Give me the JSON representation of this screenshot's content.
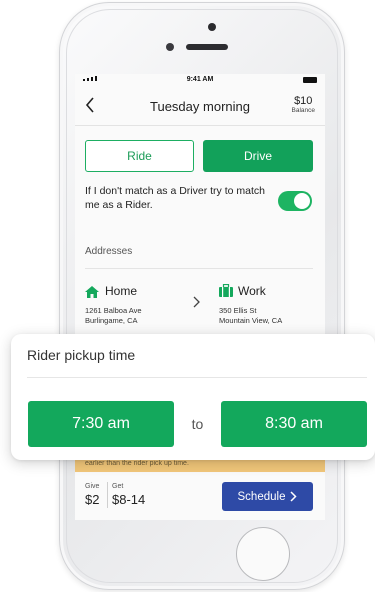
{
  "status_bar": {
    "time": "9:41 AM"
  },
  "header": {
    "back_icon": "chevron-left-icon",
    "title": "Tuesday morning",
    "balance_amount": "$10",
    "balance_label": "Balance"
  },
  "mode_toggle": {
    "ride_label": "Ride",
    "drive_label": "Drive",
    "selected": "Drive"
  },
  "match_option": {
    "text": "If I don't match as a Driver try to match me as a Rider.",
    "enabled": true
  },
  "addresses": {
    "label": "Addresses",
    "home": {
      "icon": "home-icon",
      "title": "Home",
      "line1": "1261 Balboa Ave",
      "line2": "Burlingame, CA"
    },
    "work": {
      "icon": "briefcase-icon",
      "title": "Work",
      "line1": "350 Ellis St",
      "line2": "Mountain View, CA"
    }
  },
  "notice": {
    "text": "earlier than the rider pick up time."
  },
  "footer": {
    "give_label": "Give",
    "give_amount": "$2",
    "get_label": "Get",
    "get_amount": "$8-14",
    "schedule_label": "Schedule"
  },
  "picker": {
    "title": "Rider pickup time",
    "start_time": "7:30 am",
    "to_label": "to",
    "end_time": "8:30 am"
  },
  "colors": {
    "green": "#13a85c",
    "blue": "#2e4aa6",
    "warning": "#f2c77a"
  }
}
